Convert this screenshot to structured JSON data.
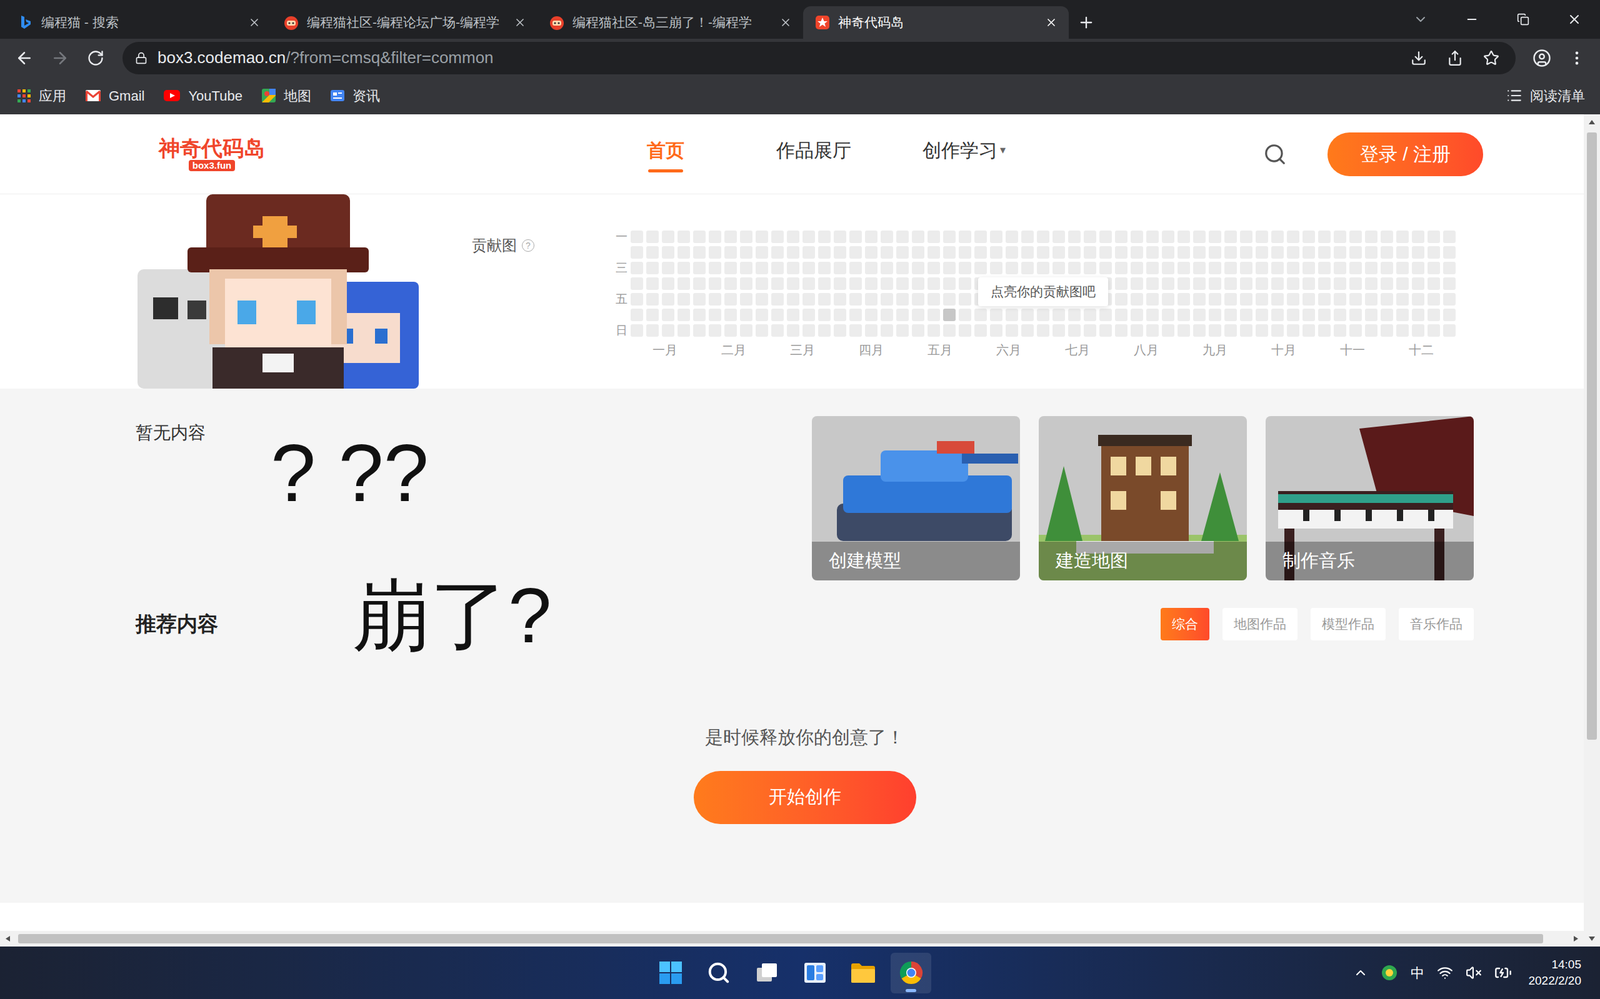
{
  "browser": {
    "tabs": [
      {
        "title": "编程猫 - 搜索",
        "kind": "bing",
        "selected": false
      },
      {
        "title": "编程猫社区-编程论坛广场-编程学",
        "kind": "codemao",
        "selected": false
      },
      {
        "title": "编程猫社区-岛三崩了！-编程学",
        "kind": "codemao",
        "selected": false
      },
      {
        "title": "神奇代码岛",
        "kind": "box3",
        "selected": true
      }
    ],
    "address": {
      "host": "box3.codemao.cn",
      "path": "/?from=cmsq&filter=common"
    },
    "bookmarks": [
      {
        "label": "应用",
        "kind": "apps"
      },
      {
        "label": "Gmail",
        "kind": "gmail"
      },
      {
        "label": "YouTube",
        "kind": "youtube"
      },
      {
        "label": "地图",
        "kind": "maps"
      },
      {
        "label": "资讯",
        "kind": "news"
      }
    ],
    "reading_list": "阅读清单"
  },
  "site": {
    "logo": {
      "title": "神奇代码岛",
      "subtitle": "box3.fun"
    },
    "nav": [
      {
        "label": "首页",
        "selected": true,
        "dropdown": false
      },
      {
        "label": "作品展厅",
        "selected": false,
        "dropdown": false
      },
      {
        "label": "创作学习",
        "selected": false,
        "dropdown": true
      }
    ],
    "caret": "▾",
    "login": "登录 / 注册"
  },
  "contribution": {
    "label": "贡献图",
    "help": "?",
    "days": [
      "一",
      "",
      "三",
      "",
      "五",
      "",
      "日"
    ],
    "months": [
      "一月",
      "二月",
      "三月",
      "四月",
      "五月",
      "六月",
      "七月",
      "八月",
      "九月",
      "十月",
      "十一",
      "十二"
    ],
    "weeks": 53,
    "active_cells": [
      {
        "week": 20,
        "day": 5,
        "level": 1
      }
    ],
    "tooltip": "点亮你的贡献图吧"
  },
  "empty_text": "暂无内容",
  "cards": [
    {
      "label": "创建模型",
      "kind": "model"
    },
    {
      "label": "建造地图",
      "kind": "map"
    },
    {
      "label": "制作音乐",
      "kind": "music"
    }
  ],
  "recommend": {
    "title": "推荐内容",
    "filters": [
      {
        "label": "综合",
        "selected": true
      },
      {
        "label": "地图作品",
        "selected": false
      },
      {
        "label": "模型作品",
        "selected": false
      },
      {
        "label": "音乐作品",
        "selected": false
      }
    ],
    "prompt": "是时候释放你的创意了！",
    "button": "开始创作"
  },
  "annotations": [
    "? ??",
    "崩了?"
  ],
  "taskbar": {
    "apps": [
      {
        "kind": "start",
        "selected": false
      },
      {
        "kind": "search",
        "selected": false
      },
      {
        "kind": "taskview",
        "selected": false
      },
      {
        "kind": "widgets",
        "selected": false
      },
      {
        "kind": "explorer",
        "selected": false
      },
      {
        "kind": "chrome",
        "selected": true
      }
    ],
    "ime": "中",
    "sound_muted": true,
    "time": "14:05",
    "date": "2022/2/20"
  }
}
